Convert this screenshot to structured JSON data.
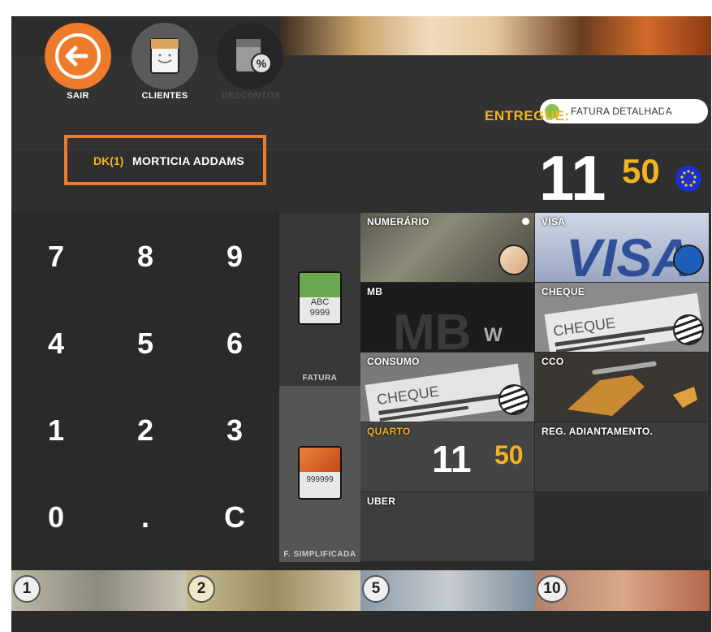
{
  "header": {
    "buttons": [
      {
        "label": "SAIR",
        "icon": "back-arrow-icon",
        "color": "#ee7b2b"
      },
      {
        "label": "CLIENTES",
        "icon": "client-card-icon",
        "color": "#5a5a5a"
      },
      {
        "label": "DESCONTOS",
        "icon": "discount-percent-icon",
        "color": "#262626",
        "disabled": true
      }
    ],
    "toggle_label": "FATURA DETALHADA",
    "entregue_label": "ENTREGUE:",
    "entregue_value": "11,50"
  },
  "customer": {
    "code": "DK(1)",
    "name": "MORTICIA ADDAMS"
  },
  "total": {
    "integer": "11",
    "decimal": "50",
    "currency_icon": "euro-flag-icon"
  },
  "keypad": [
    "7",
    "8",
    "9",
    "4",
    "5",
    "6",
    "1",
    "2",
    "3",
    "0",
    ".",
    "C"
  ],
  "documents": [
    {
      "label": "FATURA",
      "icon_line1": "ABC",
      "icon_line2": "9999"
    },
    {
      "label": "F. SIMPLIFICADA",
      "icon_line1": "999999"
    }
  ],
  "payments": [
    {
      "label": "NUMERÁRIO"
    },
    {
      "label": "VISA"
    },
    {
      "label": "MB"
    },
    {
      "label": "CHEQUE"
    },
    {
      "label": "CONSUMO"
    },
    {
      "label": "CCO"
    },
    {
      "label": "QUARTO",
      "integer": "11",
      "decimal": "50"
    },
    {
      "label": "REG. ADIANTAMENTO."
    },
    {
      "label": "UBER"
    }
  ],
  "coins": [
    "1",
    "2",
    "5",
    "10"
  ],
  "colors": {
    "accent": "#ee7b2b",
    "highlight": "#f2b320",
    "toggle_on": "#8cc04b"
  }
}
